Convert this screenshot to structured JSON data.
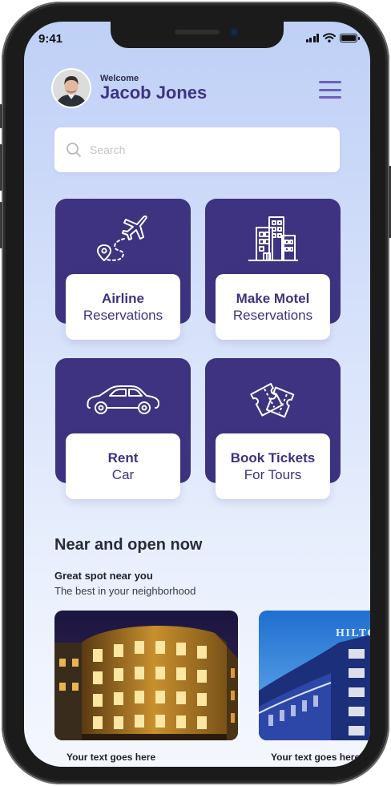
{
  "status_bar": {
    "time": "9:41",
    "battery_level": 1.0
  },
  "header": {
    "welcome": "Welcome",
    "user_name": "Jacob Jones",
    "avatar_icon": "user-avatar",
    "menu_icon": "hamburger-menu-icon"
  },
  "search": {
    "placeholder": "Search",
    "icon": "search-icon"
  },
  "services": [
    {
      "title": "Airline",
      "subtitle": "Reservations",
      "icon": "airplane-icon"
    },
    {
      "title": "Make Motel",
      "subtitle": "Reservations",
      "icon": "building-icon"
    },
    {
      "title": "Rent",
      "subtitle": "Car",
      "icon": "car-icon"
    },
    {
      "title": "Book Tickets",
      "subtitle": "For Tours",
      "icon": "ticket-icon"
    }
  ],
  "near": {
    "title": "Near and open now",
    "subtitle": "Great spot near you",
    "description": "The best in your neighborhood",
    "cards": [
      {
        "caption": "Your text goes here",
        "image": "hotel-night-photo"
      },
      {
        "caption": "Your text goes here",
        "image": "hilton-hotel-photo",
        "sign_text": "HILTO"
      }
    ]
  },
  "colors": {
    "tile": "#3d3380",
    "accent": "#6b5fc0",
    "name": "#3d3384",
    "background_top": "#bfd0f6",
    "background_bottom": "#f4f7fe"
  }
}
